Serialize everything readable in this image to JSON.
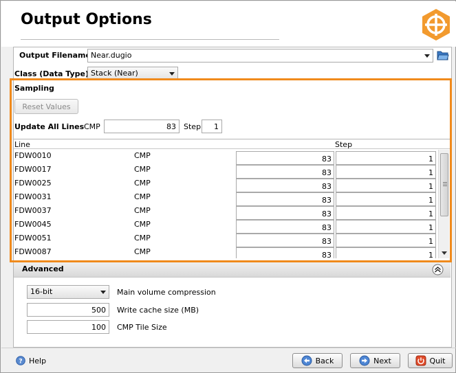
{
  "page_title": "Output Options",
  "output_filename": {
    "label": "Output Filename",
    "value": "Near.dugio"
  },
  "class_data_type": {
    "label": "Class (Data Type)",
    "value": "Stack (Near)"
  },
  "sampling": {
    "label": "Sampling",
    "reset_label": "Reset Values",
    "update_all_label": "Update All Lines",
    "cmp_label": "CMP",
    "cmp_value": "83",
    "step_label": "Step",
    "step_value": "1",
    "table": {
      "columns": [
        "Line",
        "Step"
      ],
      "rows": [
        {
          "line": "FDW0010",
          "type": "CMP",
          "cmp": "83",
          "step": "1"
        },
        {
          "line": "FDW0017",
          "type": "CMP",
          "cmp": "83",
          "step": "1"
        },
        {
          "line": "FDW0025",
          "type": "CMP",
          "cmp": "83",
          "step": "1"
        },
        {
          "line": "FDW0031",
          "type": "CMP",
          "cmp": "83",
          "step": "1"
        },
        {
          "line": "FDW0037",
          "type": "CMP",
          "cmp": "83",
          "step": "1"
        },
        {
          "line": "FDW0045",
          "type": "CMP",
          "cmp": "83",
          "step": "1"
        },
        {
          "line": "FDW0051",
          "type": "CMP",
          "cmp": "83",
          "step": "1"
        },
        {
          "line": "FDW0087",
          "type": "CMP",
          "cmp": "83",
          "step": "1"
        }
      ]
    }
  },
  "advanced": {
    "label": "Advanced",
    "compression": {
      "value": "16-bit",
      "label": "Main volume compression"
    },
    "write_cache": {
      "value": "500",
      "label": "Write cache size (MB)"
    },
    "cmp_tile": {
      "value": "100",
      "label": "CMP Tile Size"
    }
  },
  "footer": {
    "help": "Help",
    "back": "Back",
    "next": "Next",
    "quit": "Quit"
  },
  "colors": {
    "accent_orange": "#f08a1c",
    "logo_orange": "#f29a2e"
  },
  "icons": [
    "logo-crosshair-icon",
    "folder-open-icon",
    "collapse-chevron-icon",
    "help-icon",
    "back-arrow-icon",
    "next-arrow-icon",
    "power-icon"
  ]
}
